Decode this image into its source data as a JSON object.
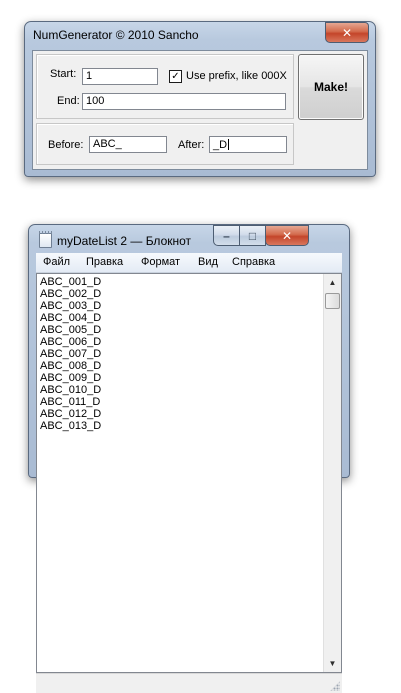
{
  "numgen": {
    "title": "NumGenerator © 2010 Sancho",
    "start_label": "Start:",
    "start_value": "1",
    "end_label": "End:",
    "end_value": "100",
    "prefix_checked": true,
    "prefix_check_mark": "✓",
    "prefix_label": "Use prefix, like 000X",
    "make_label": "Make!",
    "before_label": "Before:",
    "before_value": "ABC_",
    "after_label": "After:",
    "after_value": "_D",
    "close_glyph": "✕"
  },
  "notepad": {
    "title": "myDateList 2 — Блокнот",
    "min_glyph": "–",
    "max_glyph": "□",
    "close_glyph": "✕",
    "menu": [
      "Файл",
      "Правка",
      "Формат",
      "Вид",
      "Справка"
    ],
    "lines": [
      "ABC_001_D",
      "ABC_002_D",
      "ABC_003_D",
      "ABC_004_D",
      "ABC_005_D",
      "ABC_006_D",
      "ABC_007_D",
      "ABC_008_D",
      "ABC_009_D",
      "ABC_010_D",
      "ABC_011_D",
      "ABC_012_D",
      "ABC_013_D"
    ],
    "scroll_up_glyph": "▲",
    "scroll_down_glyph": "▼"
  }
}
